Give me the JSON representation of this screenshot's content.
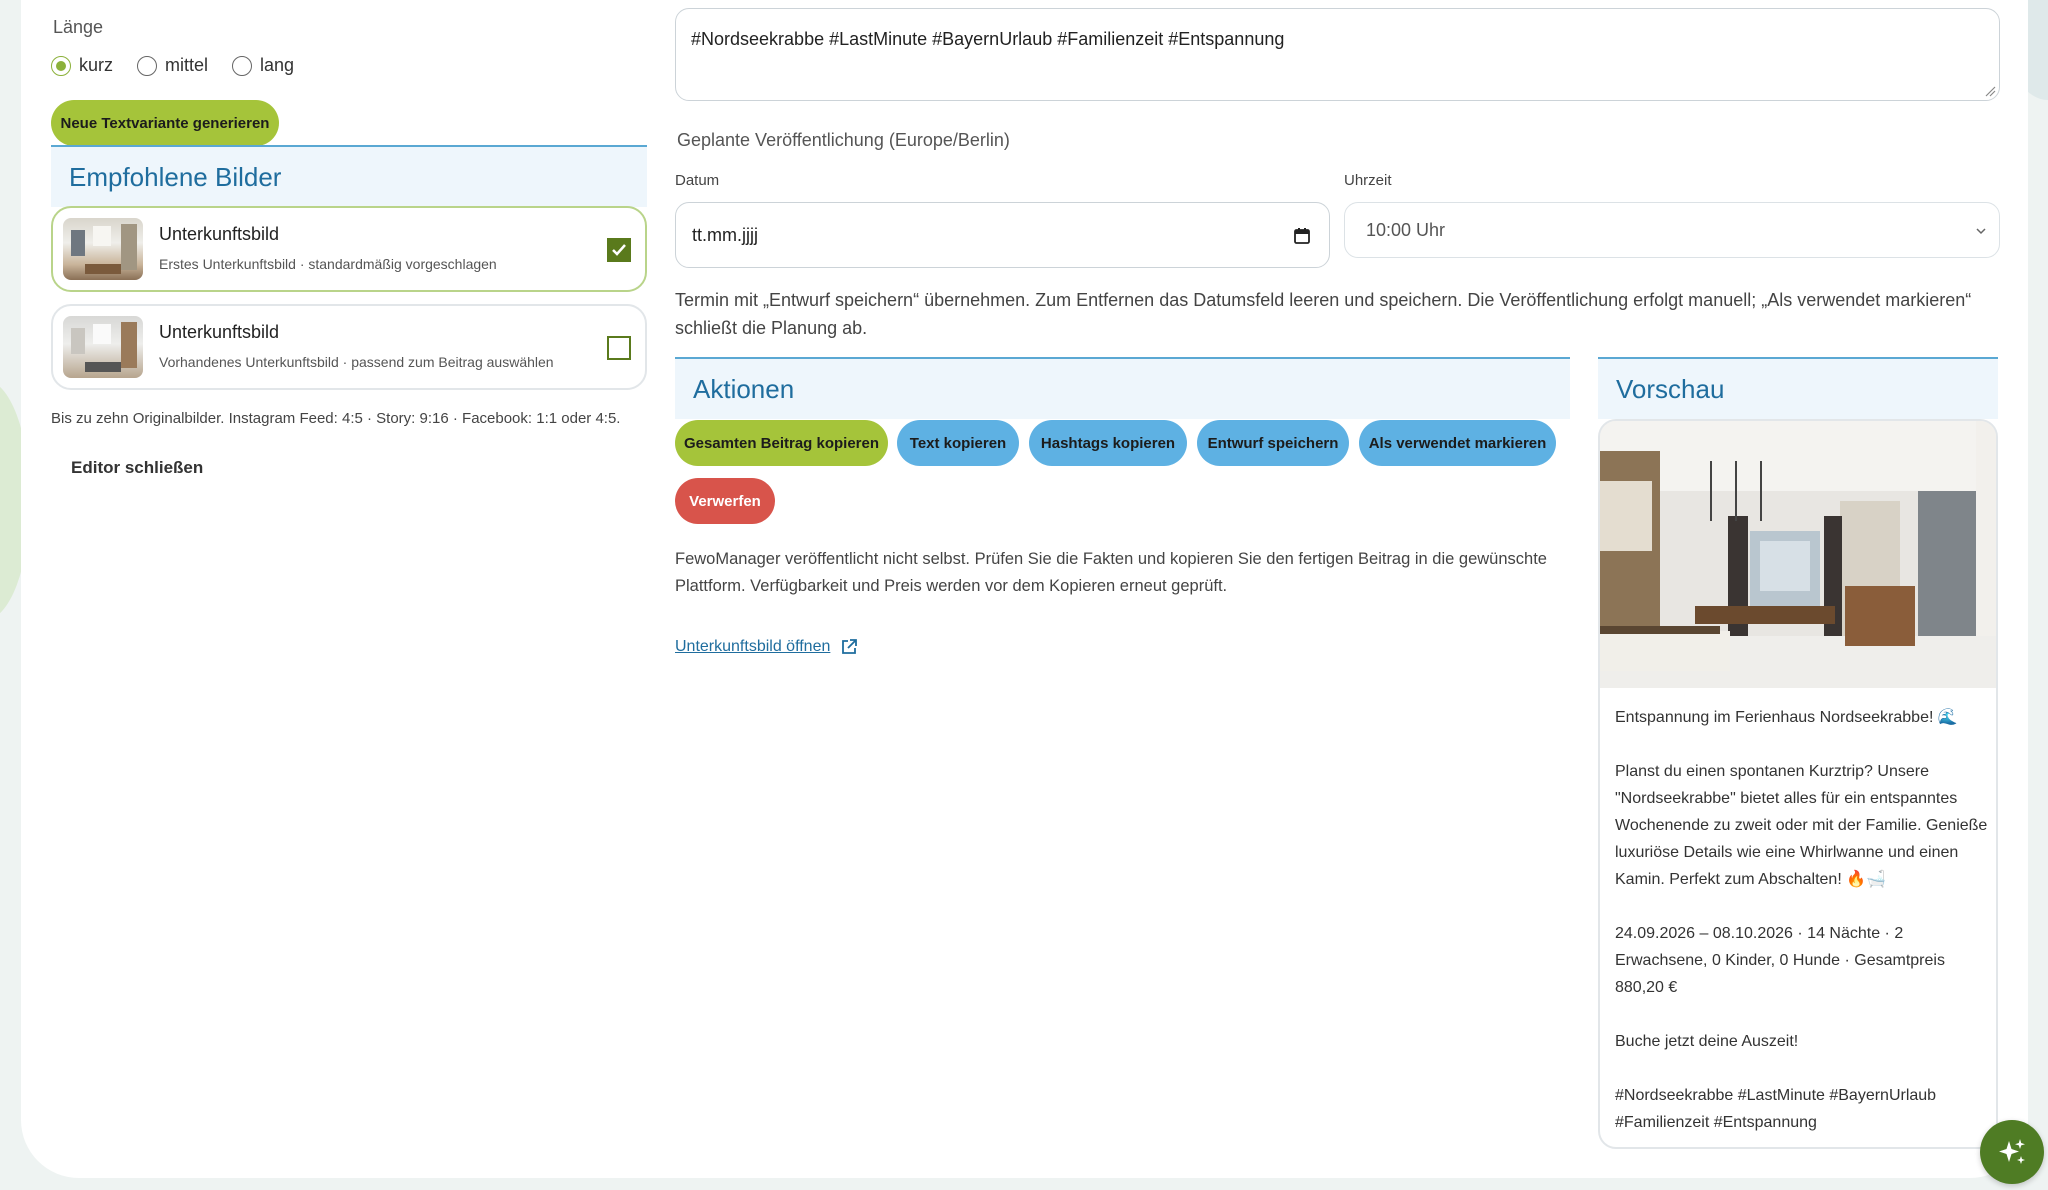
{
  "laenge": {
    "label": "Länge",
    "options": [
      "kurz",
      "mittel",
      "lang"
    ],
    "selected": "kurz"
  },
  "generate_button": "Neue Textvariante generieren",
  "images_section": {
    "title": "Empfohlene Bilder",
    "items": [
      {
        "title": "Unterkunftsbild",
        "subtitle": "Erstes Unterkunftsbild · standardmäßig vorgeschlagen",
        "checked": true
      },
      {
        "title": "Unterkunftsbild",
        "subtitle": "Vorhandenes Unterkunftsbild · passend zum Beitrag auswählen",
        "checked": false
      }
    ],
    "hint": "Bis zu zehn Originalbilder. Instagram Feed: 4:5 · Story: 9:16 · Facebook: 1:1 oder 4:5."
  },
  "close_editor": "Editor schließen",
  "hashtags_value": "#Nordseekrabbe #LastMinute #BayernUrlaub #Familienzeit #Entspannung",
  "schedule": {
    "label": "Geplante Veröffentlichung (Europe/Berlin)",
    "date_label": "Datum",
    "date_placeholder": "tt.mm.jjjj",
    "time_label": "Uhrzeit",
    "time_value": "10:00 Uhr",
    "note": "Termin mit „Entwurf speichern“ übernehmen. Zum Entfernen das Datumsfeld leeren und speichern. Die Veröffentlichung erfolgt manuell; „Als verwendet markieren“ schließt die Planung ab."
  },
  "actions": {
    "title": "Aktionen",
    "copy_all": "Gesamten Beitrag kopieren",
    "copy_text": "Text kopieren",
    "copy_hashtags": "Hashtags kopieren",
    "save_draft": "Entwurf speichern",
    "mark_used": "Als verwendet markieren",
    "discard": "Verwerfen",
    "note": "FewoManager veröffentlicht nicht selbst. Prüfen Sie die Fakten und kopieren Sie den fertigen Beitrag in die gewünschte Plattform. Verfügbarkeit und Preis werden vor dem Kopieren erneut geprüft.",
    "open_image": "Unterkunftsbild öffnen"
  },
  "preview": {
    "title": "Vorschau",
    "text": "Entspannung im Ferienhaus Nordseekrabbe! 🌊\n\nPlanst du einen spontanen Kurztrip? Unsere \"Nordseekrabbe\" bietet alles für ein entspanntes Wochenende zu zweit oder mit der Familie. Genieße luxuriöse Details wie eine Whirlwanne und einen Kamin. Perfekt zum Abschalten! 🔥🛁\n\n24.09.2026 – 08.10.2026 · 14 Nächte · 2 Erwachsene, 0 Kinder, 0 Hunde · Gesamtpreis 880,20 €\n\nBuche jetzt deine Auszeit!\n\n#Nordseekrabbe #LastMinute #BayernUrlaub #Familienzeit #Entspannung"
  },
  "colors": {
    "accent_green": "#a5c43a",
    "accent_blue": "#5eb1e3",
    "danger_red": "#d8544b",
    "heading_blue": "#1f6d9e",
    "fab_green": "#4f7c24"
  }
}
